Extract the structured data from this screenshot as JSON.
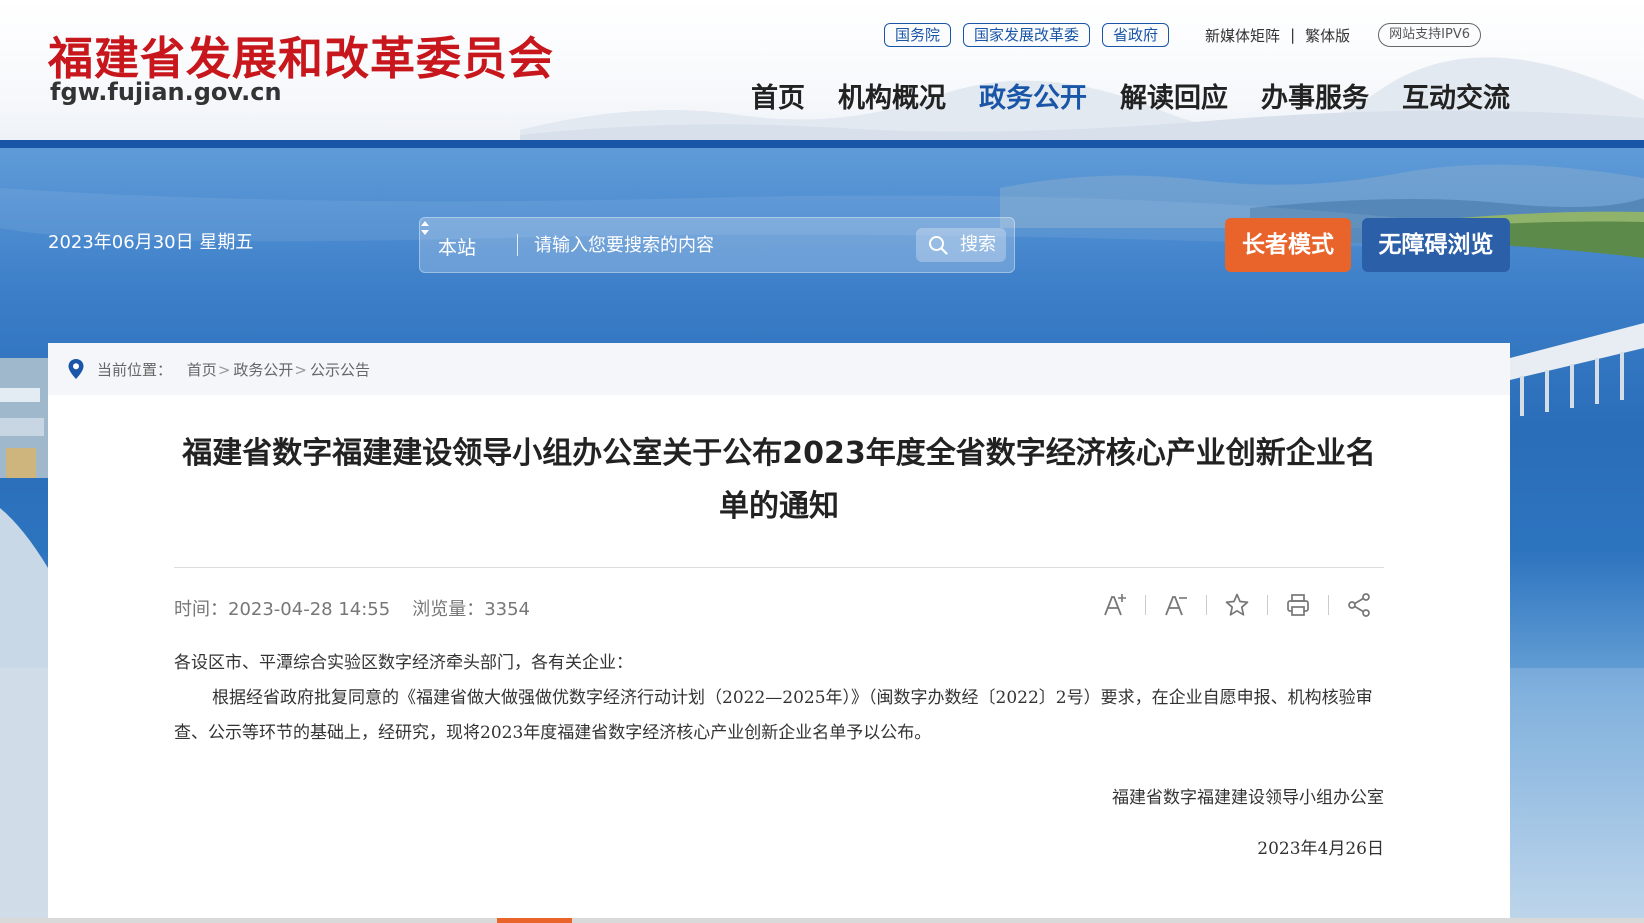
{
  "header": {
    "logo_cn": "福建省发展和改革委员会",
    "logo_en": "fgw.fujian.gov.cn",
    "top_links": [
      "国务院",
      "国家发展改革委",
      "省政府"
    ],
    "media_matrix": "新媒体矩阵",
    "separator": "|",
    "traditional": "繁体版",
    "ipv6": "网站支持IPV6",
    "nav": [
      "首页",
      "机构概况",
      "政务公开",
      "解读回应",
      "办事服务",
      "互动交流"
    ],
    "active_nav": "政务公开",
    "brand_color": "#c8161d",
    "accent_color": "#1a56a8"
  },
  "banner": {
    "date": "2023年06月30日 星期五",
    "search": {
      "scope": "本站",
      "placeholder": "请输入您要搜索的内容",
      "button": "搜索"
    },
    "elder_mode": "长者模式",
    "accessible": "无障碍浏览"
  },
  "breadcrumb": {
    "label": "当前位置：",
    "items": [
      "首页",
      "政务公开",
      "公示公告"
    ],
    "separator": ">"
  },
  "article": {
    "title": "福建省数字福建建设领导小组办公室关于公布2023年度全省数字经济核心产业创新企业名单的通知",
    "time_label": "时间：",
    "time": "2023-04-28 14:55",
    "views_label": "浏览量：",
    "views": "3354",
    "tools": [
      "font-increase-icon",
      "font-decrease-icon",
      "star-icon",
      "print-icon",
      "share-icon"
    ],
    "salutation": "各设区市、平潭综合实验区数字经济牵头部门，各有关企业：",
    "paragraph": "根据经省政府批复同意的《福建省做大做强做优数字经济行动计划（2022—2025年）》（闽数字办数经〔2022〕2号）要求，在企业自愿申报、机构核验审查、公示等环节的基础上，经研究，现将2023年度福建省数字经济核心产业创新企业名单予以公布。",
    "signature": "福建省数字福建建设领导小组办公室",
    "sign_date": "2023年4月26日"
  }
}
